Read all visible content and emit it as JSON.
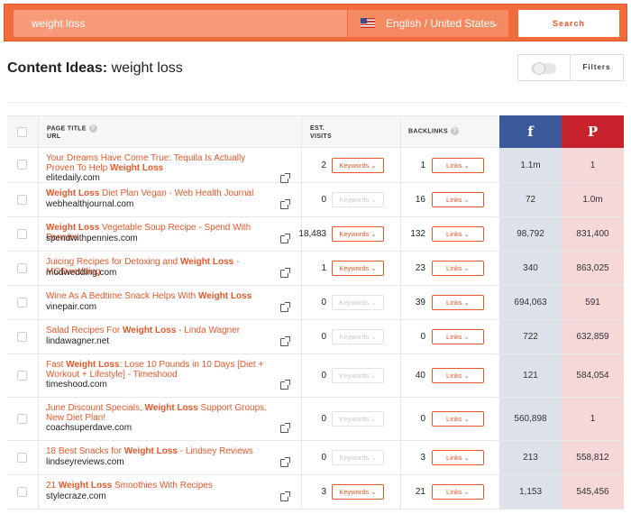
{
  "search": {
    "query": "weight loss",
    "language": "English / United States",
    "button": "Search"
  },
  "header": {
    "title_prefix": "Content Ideas:",
    "title_term": "weight loss",
    "filters": "Filters"
  },
  "table": {
    "col_page_title": "PAGE TITLE",
    "col_url": "URL",
    "col_est": "EST.",
    "col_visits": "VISITS",
    "col_backlinks": "BACKLINKS",
    "facebook_glyph": "f",
    "pinterest_glyph": "P",
    "keywords_label": "Keywords",
    "links_label": "Links",
    "rows": [
      {
        "pre": "Your Dreams Have Come True: Tequila Is Actually Proven To Help ",
        "kw": "Weight Loss",
        "post": "",
        "url": "elitedaily.com",
        "visits": "2",
        "kw_active": true,
        "backlinks": "1",
        "facebook": "1.1m",
        "pinterest": "1",
        "h": 39
      },
      {
        "pre": "",
        "kw": "Weight Loss",
        "post": " Diet Plan Vegan - Web Health Journal",
        "url": "webhealthjournal.com",
        "visits": "0",
        "kw_active": false,
        "backlinks": "16",
        "facebook": "72",
        "pinterest": "1.0m",
        "h": 38
      },
      {
        "pre": "",
        "kw": "Weight Loss",
        "post": " Vegetable Soup Recipe - Spend With Pennies",
        "url": "spendwithpennies.com",
        "visits": "18,483",
        "kw_active": true,
        "backlinks": "132",
        "facebook": "98,792",
        "pinterest": "831,400",
        "h": 38
      },
      {
        "pre": "Juicing Recipes for Detoxing and ",
        "kw": "Weight Loss",
        "post": " - MODwedding",
        "url": "modwedding.com",
        "visits": "1",
        "kw_active": true,
        "backlinks": "23",
        "facebook": "340",
        "pinterest": "863,025",
        "h": 38
      },
      {
        "pre": "Wine As A Bedtime Snack Helps With ",
        "kw": "Weight Loss",
        "post": "",
        "url": "vinepair.com",
        "visits": "0",
        "kw_active": false,
        "backlinks": "39",
        "facebook": "694,063",
        "pinterest": "591",
        "h": 38
      },
      {
        "pre": "Salad Recipes For ",
        "kw": "Weight Loss",
        "post": " - Linda Wagner",
        "url": "lindawagner.net",
        "visits": "0",
        "kw_active": false,
        "backlinks": "0",
        "facebook": "722",
        "pinterest": "632,859",
        "h": 38
      },
      {
        "pre": "Fast ",
        "kw": "Weight Loss",
        "post": ": Lose 10 Pounds in 10 Days [Diet + Workout + Lifestyle] - Timeshood",
        "url": "timeshood.com",
        "visits": "0",
        "kw_active": false,
        "backlinks": "40",
        "facebook": "121",
        "pinterest": "584,054",
        "h": 48
      },
      {
        "pre": "June Discount Specials, ",
        "kw": "Weight Loss",
        "post": " Support Groups, New Diet Plan!",
        "url": "coachsuperdave.com",
        "visits": "0",
        "kw_active": false,
        "backlinks": "0",
        "facebook": "560,898",
        "pinterest": "1",
        "h": 48
      },
      {
        "pre": "18 Best Snacks for ",
        "kw": "Weight Loss",
        "post": " - Lindsey Reviews",
        "url": "lindseyreviews.com",
        "visits": "0",
        "kw_active": false,
        "backlinks": "3",
        "facebook": "213",
        "pinterest": "558,812",
        "h": 38
      },
      {
        "pre": "21 ",
        "kw": "Weight Loss",
        "post": " Smoothies With Recipes",
        "url": "stylecraze.com",
        "visits": "3",
        "kw_active": true,
        "backlinks": "21",
        "facebook": "1,153",
        "pinterest": "545,456",
        "h": 38
      }
    ]
  }
}
